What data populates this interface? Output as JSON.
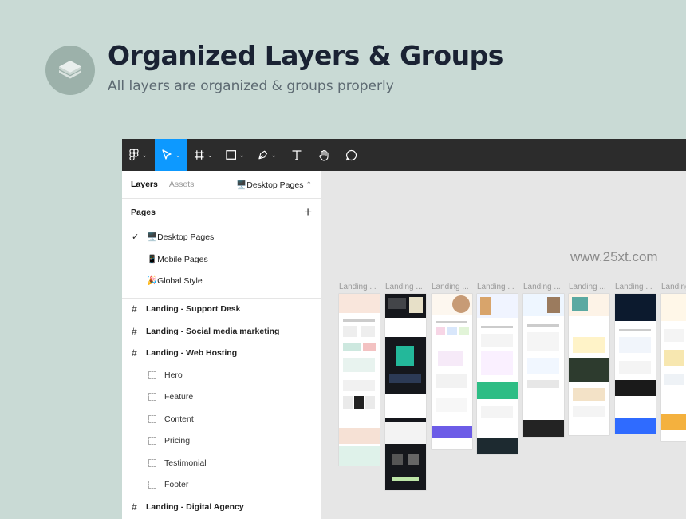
{
  "hero": {
    "title": "Organized Layers & Groups",
    "subtitle": "All layers are organized & groups properly",
    "icon": "layers-icon"
  },
  "watermark": "www.25xt.com",
  "toolbar": {
    "tools": [
      "figma-menu",
      "move",
      "frame",
      "rectangle",
      "pen",
      "text",
      "hand",
      "comment"
    ],
    "active": "move",
    "active_color": "#0d99ff"
  },
  "panel": {
    "tabs": {
      "layers": "Layers",
      "assets": "Assets"
    },
    "current_page": "🖥️Desktop Pages",
    "pages_header": "Pages",
    "pages": [
      {
        "label": "🖥️Desktop Pages",
        "selected": true
      },
      {
        "label": "📱Mobile Pages",
        "selected": false
      },
      {
        "label": "🎉Global Style",
        "selected": false
      }
    ],
    "layers": [
      {
        "label": "Landing - Support Desk"
      },
      {
        "label": "Landing - Social media marketing"
      },
      {
        "label": "Landing - Web Hosting"
      }
    ],
    "sublayers": [
      "Hero",
      "Feature",
      "Content",
      "Pricing",
      "Testimonial",
      "Footer"
    ],
    "last_layer": "Landing - Digital Agency"
  },
  "canvas": {
    "frame_labels": [
      "Landing ...",
      "Landing ...",
      "Landing ...",
      "Landing ...",
      "Landing ...",
      "Landing ...",
      "Landing ...",
      "Landing"
    ]
  }
}
